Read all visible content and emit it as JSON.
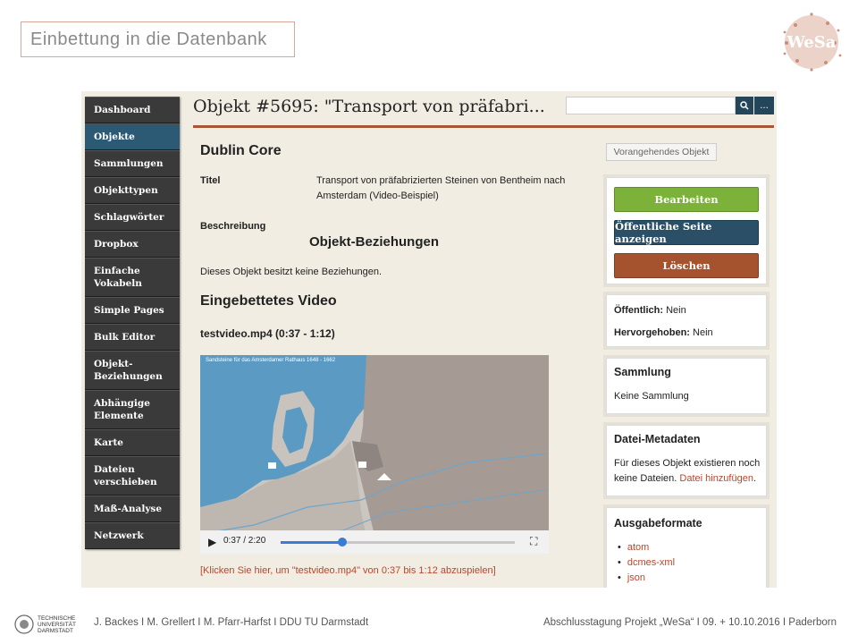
{
  "slide": {
    "title": "Einbettung in die Datenbank",
    "footer_left": "J. Backes I M. Grellert I M. Pfarr-Harfst I DDU TU Darmstadt",
    "footer_right": "Abschlusstagung Projekt „WeSa“ I 09. + 10.10.2016 I Paderborn",
    "logo_text": "WeSa",
    "tu_lines": [
      "TECHNISCHE",
      "UNIVERSITÄT",
      "DARMSTADT"
    ]
  },
  "colors": {
    "accent": "#a65636",
    "nav_active": "#2c5a75",
    "edit": "#7cb23a",
    "public": "#2a4f66",
    "delete": "#a5522f"
  },
  "sidebar": {
    "items": [
      {
        "label": "Dashboard"
      },
      {
        "label": "Objekte",
        "active": true
      },
      {
        "label": "Sammlungen"
      },
      {
        "label": "Objekttypen"
      },
      {
        "label": "Schlagwörter"
      },
      {
        "label": "Dropbox"
      },
      {
        "label": "Einfache Vokabeln"
      },
      {
        "label": "Simple Pages"
      },
      {
        "label": "Bulk Editor"
      },
      {
        "label": "Objekt-Beziehungen"
      },
      {
        "label": "Abhängige Elemente"
      },
      {
        "label": "Karte"
      },
      {
        "label": "Dateien verschieben"
      },
      {
        "label": "Maß-Analyse"
      },
      {
        "label": "Netzwerk"
      }
    ]
  },
  "header": {
    "title": "Objekt #5695: \"Transport von präfabri...",
    "search_placeholder": "",
    "more_label": "..."
  },
  "main": {
    "dublin_core": "Dublin Core",
    "titel_label": "Titel",
    "titel_value": "Transport von präfabrizierten Steinen von Bentheim nach Amsterdam (Video-Beispiel)",
    "beschreibung_label": "Beschreibung",
    "relations_heading": "Objekt-Beziehungen",
    "relations_text": "Dieses Objekt besitzt keine Beziehungen.",
    "video_heading": "Eingebettetes Video",
    "video_file": "testvideo.mp4 (0:37 - 1:12)",
    "video_caption": "Sandsteine für das Amsterdamer Rathaus   1648 - 1662",
    "video_time": "0:37 / 2:20",
    "video_progress": 0.264,
    "play_link": "[Klicken Sie hier, um \"testvideo.mp4\" von 0:37 bis 1:12 abzuspielen]"
  },
  "right": {
    "prev_button": "Vorangehendes Objekt",
    "edit_button": "Bearbeiten",
    "public_button": "Öffentliche Seite anzeigen",
    "delete_button": "Löschen",
    "oeffentlich_label": "Öffentlich:",
    "oeffentlich_value": "Nein",
    "hervorgehoben_label": "Hervorgehoben:",
    "hervorgehoben_value": "Nein",
    "sammlung_title": "Sammlung",
    "sammlung_value": "Keine Sammlung",
    "meta_title": "Datei-Metadaten",
    "meta_text": "Für dieses Objekt existieren noch keine Dateien.",
    "meta_link": "Datei hinzufügen",
    "formats_title": "Ausgabeformate",
    "formats": [
      "atom",
      "dcmes-xml",
      "json"
    ]
  }
}
